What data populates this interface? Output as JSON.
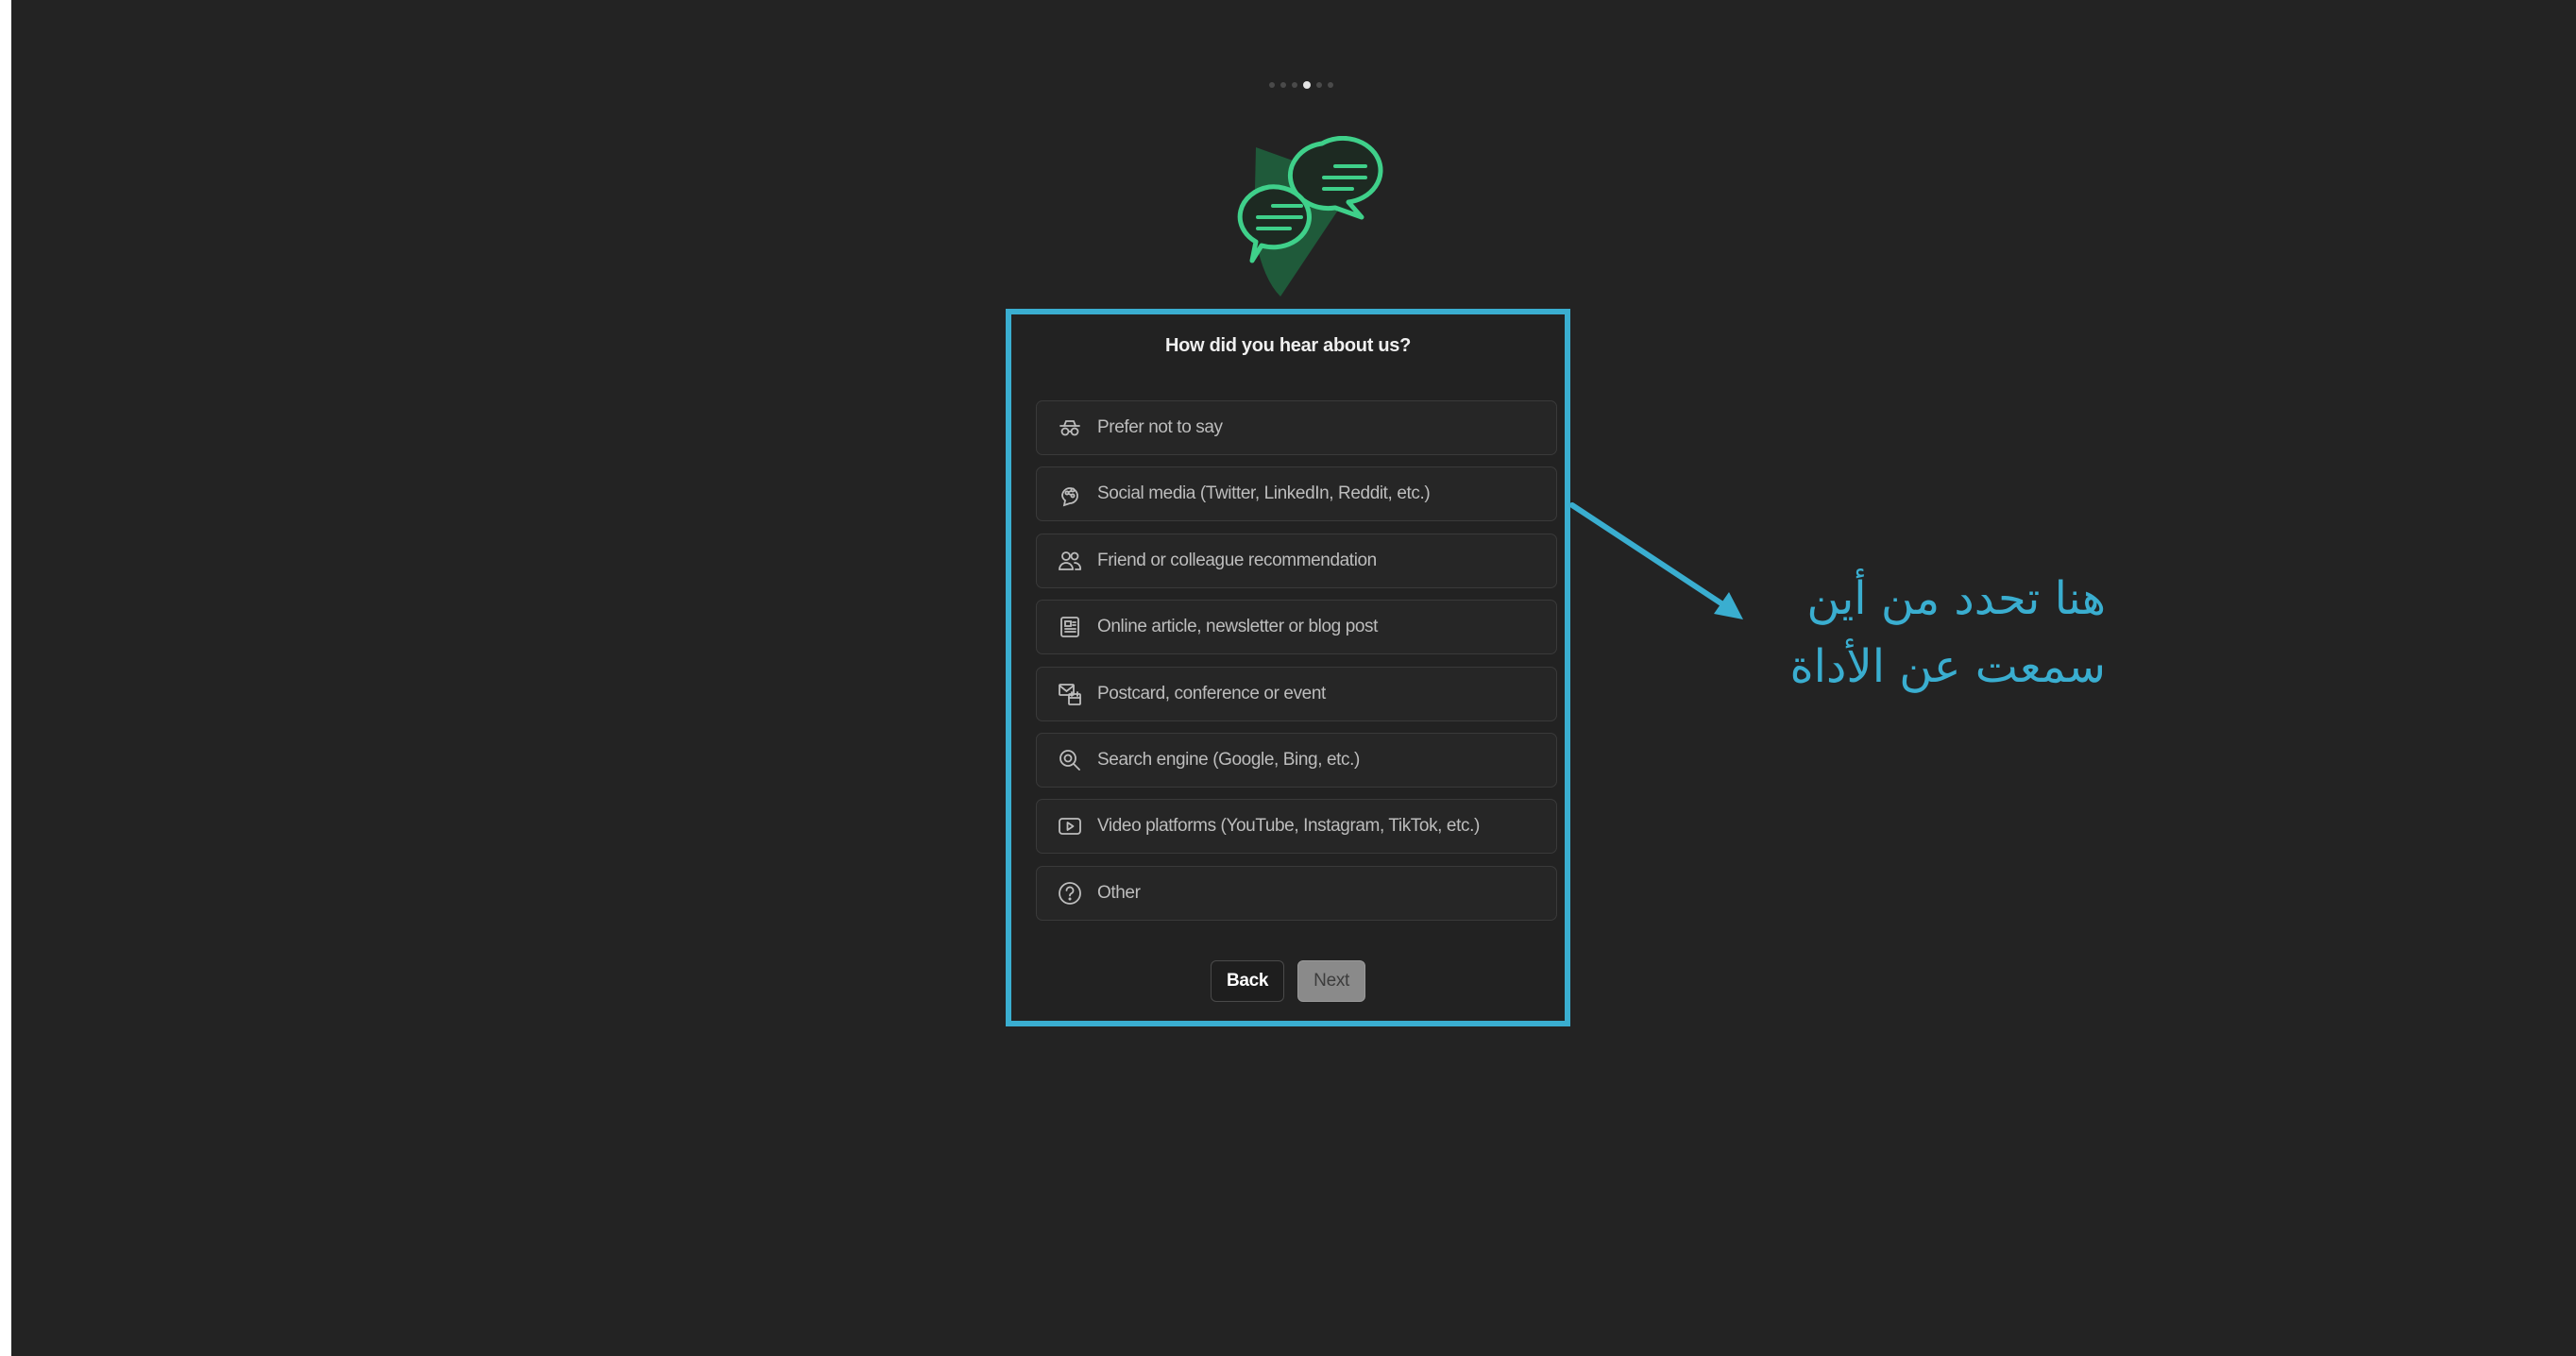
{
  "progress": {
    "total_steps": 6,
    "current_step": 4
  },
  "colors": {
    "background": "#232323",
    "accent_highlight": "#3aaed0",
    "brand_green": "#3fd08a",
    "brand_dark_green": "#1f5a3a"
  },
  "logo": {
    "icon": "chat-bubbles-icon"
  },
  "survey": {
    "question": "How did you hear about us?",
    "options": [
      {
        "label": "Prefer not to say",
        "icon": "incognito-icon"
      },
      {
        "label": "Social media (Twitter, LinkedIn, Reddit, etc.)",
        "icon": "social-share-icon"
      },
      {
        "label": "Friend or colleague recommendation",
        "icon": "users-icon"
      },
      {
        "label": "Online article, newsletter or blog post",
        "icon": "newspaper-icon"
      },
      {
        "label": "Postcard, conference or event",
        "icon": "postcard-calendar-icon"
      },
      {
        "label": "Search engine (Google, Bing, etc.)",
        "icon": "search-icon"
      },
      {
        "label": "Video platforms (YouTube, Instagram, TikTok, etc.)",
        "icon": "video-play-icon"
      },
      {
        "label": "Other",
        "icon": "question-circle-icon"
      }
    ],
    "back_label": "Back",
    "next_label": "Next"
  },
  "annotation": {
    "line1": "هنا تحدد من أين",
    "line2": "سمعت عن الأداة"
  }
}
